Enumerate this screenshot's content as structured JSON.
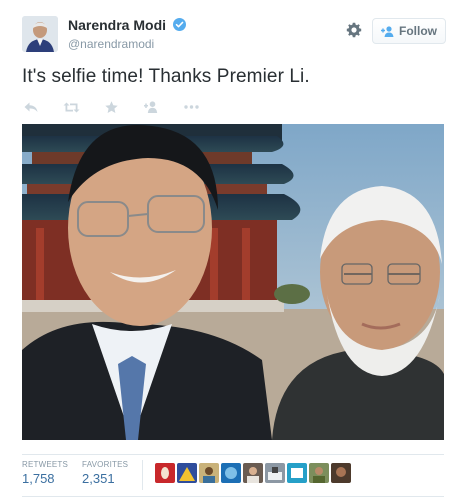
{
  "tweet": {
    "author_name": "Narendra Modi",
    "handle": "@narendramodi",
    "verified": true,
    "follow_label": "Follow",
    "text": "It's selfie time! Thanks Premier Li."
  },
  "actions": [
    {
      "icon": "reply-icon"
    },
    {
      "icon": "retweet-icon"
    },
    {
      "icon": "favorite-star-icon"
    },
    {
      "icon": "follow-person-icon"
    },
    {
      "icon": "more-dots-icon"
    }
  ],
  "stats": {
    "retweets_label": "RETWEETS",
    "retweets_count": "1,758",
    "favorites_label": "FAVORITES",
    "favorites_count": "2,351"
  },
  "favoriter_avatar_count": 9,
  "colors": {
    "text": "#292f33",
    "muted": "#8899a6",
    "link_blue": "#3b6fa0",
    "verified_blue": "#55acee",
    "border": "#e1e8ed"
  }
}
